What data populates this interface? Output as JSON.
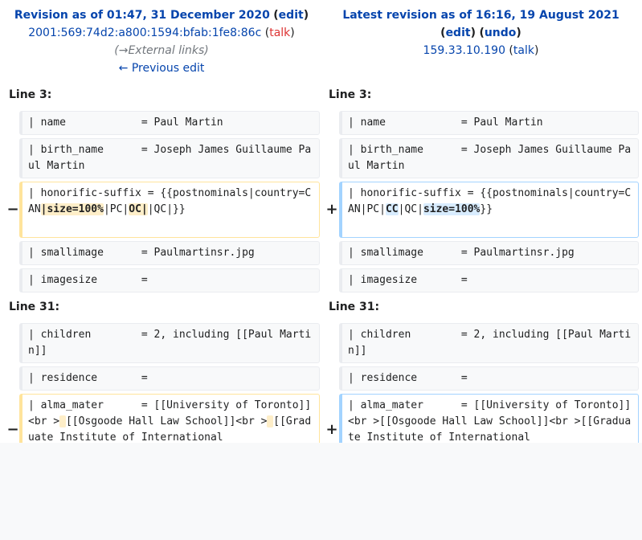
{
  "left_header": {
    "title": "Revision as of 01:47, 31 December 2020",
    "edit": "edit",
    "user": "2001:569:74d2:a800:1594:bfab:1fe8:86c",
    "talk": "talk",
    "summary_arrow": "→",
    "summary": "External links",
    "previous": "← Previous edit"
  },
  "right_header": {
    "title": "Latest revision as of 16:16, 19 August 2021",
    "edit": "edit",
    "undo": "undo",
    "user": "159.33.10.190",
    "talk": "talk"
  },
  "sections": [
    {
      "label_left": "Line 3:",
      "label_right": "Line 3:"
    },
    {
      "label_left": "Line 31:",
      "label_right": "Line 31:"
    }
  ],
  "rows": {
    "r1": {
      "text": "| name            = Paul Martin"
    },
    "r2": {
      "text": "| birth_name      = Joseph James Guillaume Paul Martin"
    },
    "r3_left": {
      "a": "| honorific-suffix = {{postnominals|country=CAN",
      "h1": "|size=100%",
      "b": "|PC|",
      "h2": "OC|",
      "c": "|QC|}}"
    },
    "r3_right": {
      "a": "| honorific-suffix = {{postnominals|country=CAN|PC|",
      "h1": "CC",
      "b": "|QC|",
      "h2": "size=100%",
      "c": "}}"
    },
    "r4": {
      "text": "| smallimage      = Paulmartinsr.jpg"
    },
    "r5": {
      "text": "| imagesize       ="
    },
    "r6": {
      "text": "| children        = 2, including [[Paul Martin]]"
    },
    "r7": {
      "text": "| residence       ="
    },
    "r8_left": {
      "a": "| alma_mater      = [[University of Toronto]]<br >",
      "h1": " ",
      "b": "[[Osgoode Hall Law School]]<br >",
      "h2": " ",
      "c": "[[Graduate Institute of International"
    },
    "r8_right": {
      "text": "| alma_mater      = [[University of Toronto]]<br >[[Osgoode Hall Law School]]<br >[[Graduate Institute of International"
    }
  },
  "markers": {
    "minus": "−",
    "plus": "+"
  }
}
